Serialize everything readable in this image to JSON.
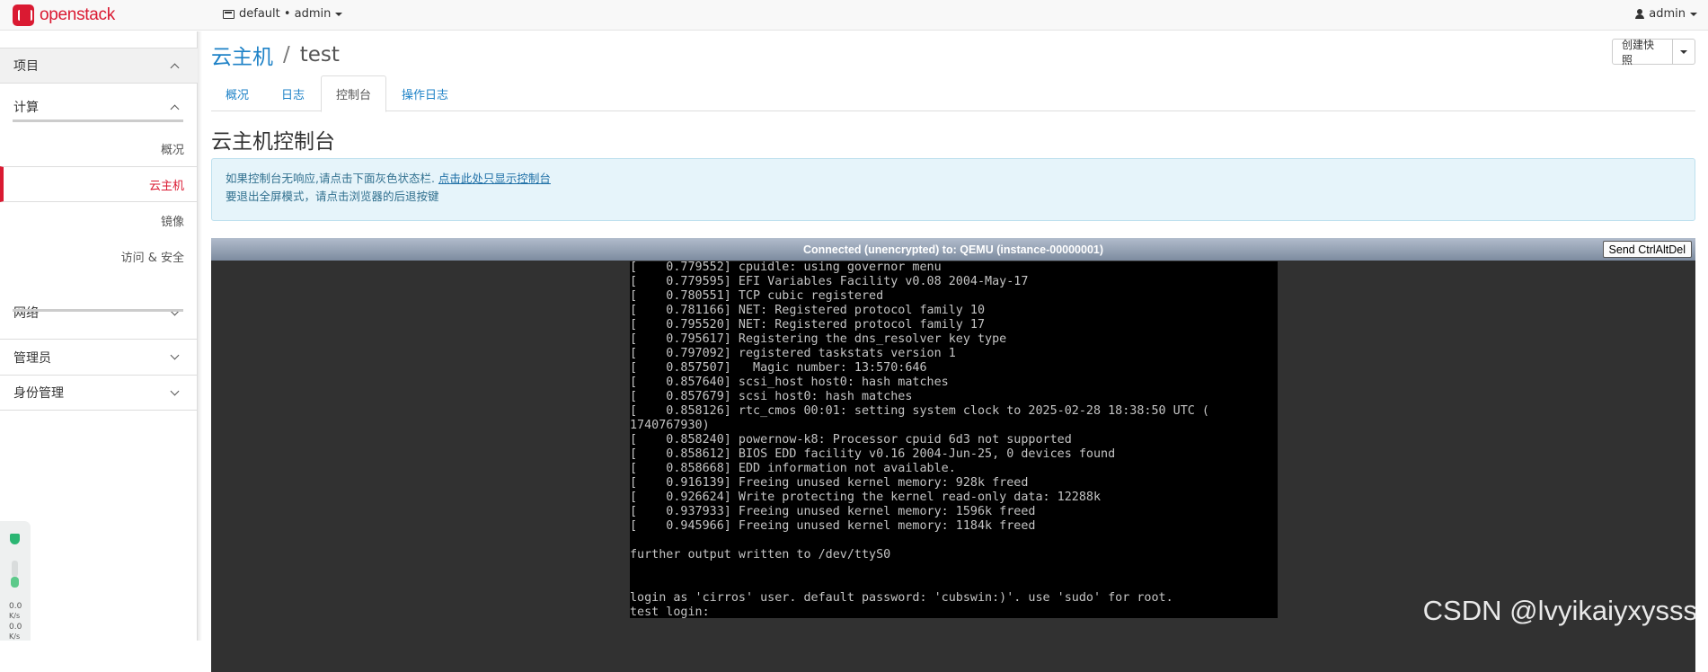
{
  "topnav": {
    "brand": "openstack",
    "project_selector": "default • admin",
    "user": "admin"
  },
  "sidebar": {
    "project": "项目",
    "compute": "计算",
    "compute_items": [
      "概况",
      "云主机",
      "镜像",
      "访问 & 安全"
    ],
    "network": "网络",
    "admin": "管理员",
    "identity": "身份管理"
  },
  "widget": {
    "up_value": "0.0",
    "up_unit": "K/s",
    "down_value": "0.0",
    "down_unit": "K/s"
  },
  "breadcrumb": {
    "parent": "云主机",
    "separator": "/",
    "current": "test"
  },
  "actions": {
    "create_snapshot": "创建快照"
  },
  "tabs": [
    "概况",
    "日志",
    "控制台",
    "操作日志"
  ],
  "active_tab": "控制台",
  "page_title": "云主机控制台",
  "alert": {
    "line1_prefix": "如果控制台无响应,请点击下面灰色状态栏. ",
    "line1_link": "点击此处只显示控制台",
    "line2": "要退出全屏模式，请点击浏览器的后退按键"
  },
  "console": {
    "status": "Connected (unencrypted) to: QEMU (instance-00000001)",
    "send_cad": "Send CtrlAltDel",
    "lines": [
      "[    0.779552] cpuidle: using governor menu",
      "[    0.779595] EFI Variables Facility v0.08 2004-May-17",
      "[    0.780551] TCP cubic registered",
      "[    0.781166] NET: Registered protocol family 10",
      "[    0.795520] NET: Registered protocol family 17",
      "[    0.795617] Registering the dns_resolver key type",
      "[    0.797092] registered taskstats version 1",
      "[    0.857507]   Magic number: 13:570:646",
      "[    0.857640] scsi_host host0: hash matches",
      "[    0.857679] scsi host0: hash matches",
      "[    0.858126] rtc_cmos 00:01: setting system clock to 2025-02-28 18:38:50 UTC (",
      "1740767930)",
      "[    0.858240] powernow-k8: Processor cpuid 6d3 not supported",
      "[    0.858612] BIOS EDD facility v0.16 2004-Jun-25, 0 devices found",
      "[    0.858668] EDD information not available.",
      "[    0.916139] Freeing unused kernel memory: 928k freed",
      "[    0.926624] Write protecting the kernel read-only data: 12288k",
      "[    0.937933] Freeing unused kernel memory: 1596k freed",
      "[    0.945966] Freeing unused kernel memory: 1184k freed",
      "",
      "further output written to /dev/ttyS0",
      "",
      "",
      "login as 'cirros' user. default password: 'cubswin:)'. use 'sudo' for root.",
      "test login:"
    ]
  },
  "watermark": "CSDN @lvyikaiyxysss",
  "colors": {
    "brand": "#da1a32",
    "link": "#1e82c7",
    "alert_bg": "#e6f4fa",
    "console_bar": "#8a97aa"
  }
}
